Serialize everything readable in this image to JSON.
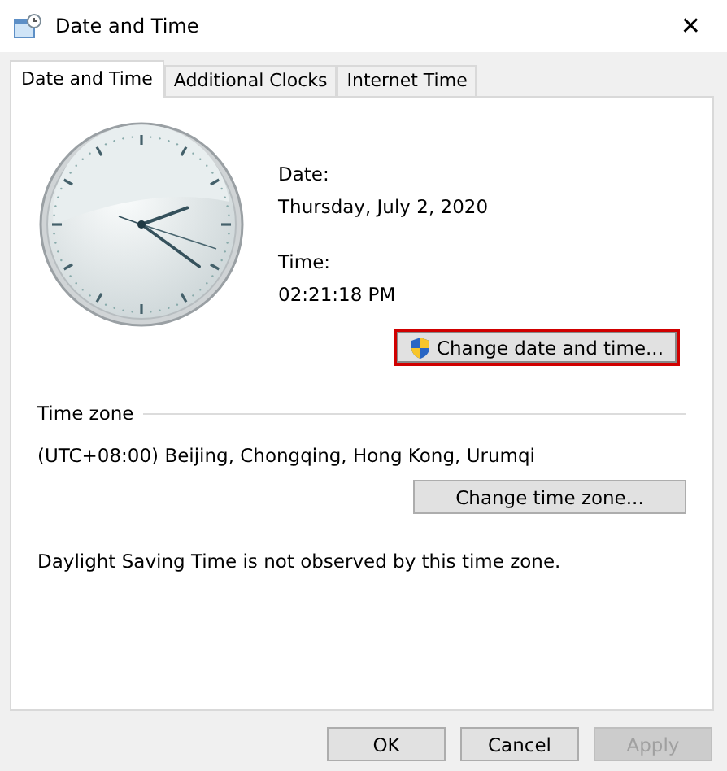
{
  "window": {
    "title": "Date and Time",
    "close": "✕"
  },
  "tabs": [
    {
      "label": "Date and Time",
      "selected": true
    },
    {
      "label": "Additional Clocks",
      "selected": false
    },
    {
      "label": "Internet Time",
      "selected": false
    }
  ],
  "date": {
    "label": "Date:",
    "value": "Thursday, July 2, 2020"
  },
  "time": {
    "label": "Time:",
    "value": "02:21:18 PM"
  },
  "change_datetime_button": {
    "label": "Change date and time...",
    "highlighted": true
  },
  "time_zone": {
    "heading": "Time zone",
    "value": "(UTC+08:00) Beijing, Chongqing, Hong Kong, Urumqi",
    "button": "Change time zone..."
  },
  "dst_note": "Daylight Saving Time is not observed by this time zone.",
  "buttons": [
    {
      "label": "OK",
      "disabled": false
    },
    {
      "label": "Cancel",
      "disabled": false
    },
    {
      "label": "Apply",
      "disabled": true
    }
  ]
}
